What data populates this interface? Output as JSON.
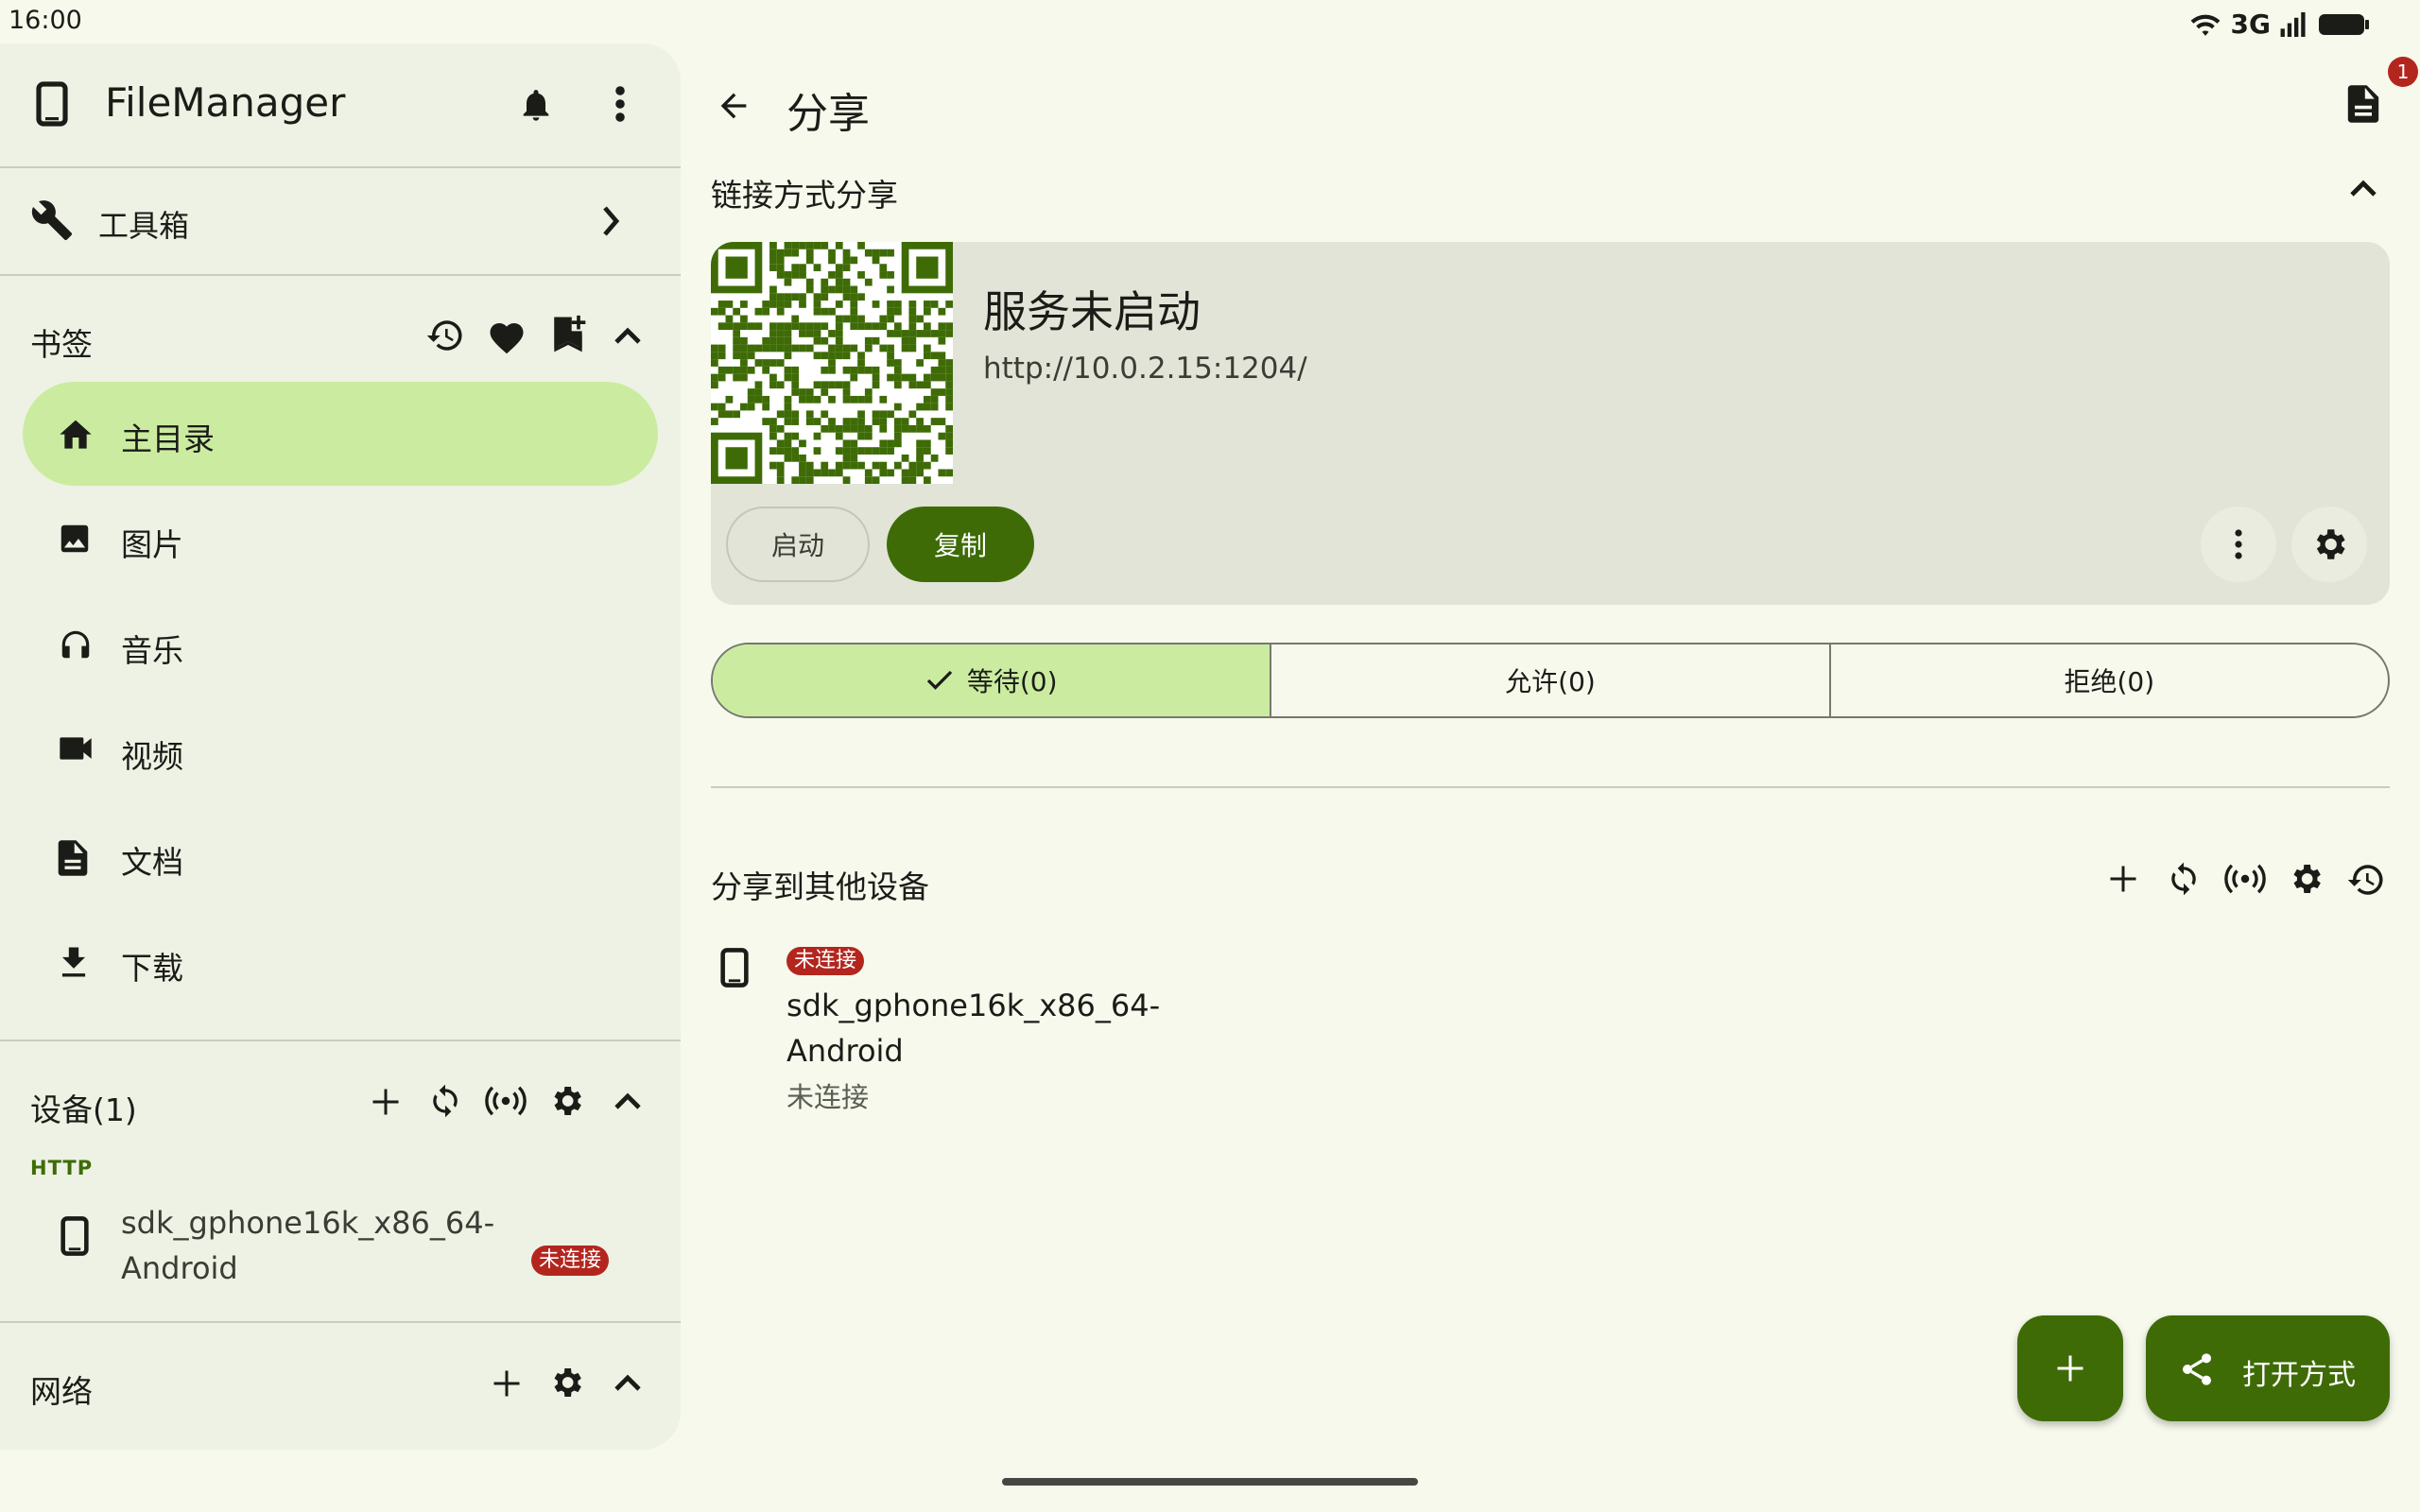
{
  "status_bar": {
    "time": "16:00",
    "network": "3G",
    "icons": [
      "wifi-icon",
      "signal-icon",
      "battery-icon"
    ]
  },
  "drawer": {
    "app_title": "FileManager",
    "header_icons": [
      "phone-icon",
      "bell-icon",
      "more-vert-icon"
    ],
    "toolbox_label": "工具箱",
    "bookmarks": {
      "title": "书签",
      "actions": [
        "history-icon",
        "heart-icon",
        "bookmark-add-icon",
        "chevron-up-icon"
      ],
      "items": [
        {
          "label": "主目录",
          "icon": "home-icon",
          "active": true
        },
        {
          "label": "图片",
          "icon": "image-icon",
          "active": false
        },
        {
          "label": "音乐",
          "icon": "headphones-icon",
          "active": false
        },
        {
          "label": "视频",
          "icon": "video-icon",
          "active": false
        },
        {
          "label": "文档",
          "icon": "document-icon",
          "active": false
        },
        {
          "label": "下载",
          "icon": "download-icon",
          "active": false
        }
      ]
    },
    "devices": {
      "title": "设备(1)",
      "actions": [
        "add-icon",
        "sync-icon",
        "broadcast-icon",
        "gear-icon",
        "chevron-up-icon"
      ],
      "group_label": "HTTP",
      "device_name": "sdk_gphone16k_x86_64-Android",
      "device_status": "未连接"
    },
    "network": {
      "title": "网络",
      "actions": [
        "add-icon",
        "gear-icon",
        "chevron-up-icon"
      ]
    }
  },
  "main": {
    "title": "分享",
    "notification_count": "1",
    "link_share": {
      "title": "链接方式分享",
      "status": "服务未启动",
      "url": "http://10.0.2.15:1204/",
      "start_label": "启动",
      "copy_label": "复制"
    },
    "segments": [
      {
        "label": "等待(0)",
        "selected": true
      },
      {
        "label": "允许(0)",
        "selected": false
      },
      {
        "label": "拒绝(0)",
        "selected": false
      }
    ],
    "share_to_devices": {
      "title": "分享到其他设备",
      "actions": [
        "add-icon",
        "sync-icon",
        "broadcast-icon",
        "gear-icon",
        "history-icon"
      ],
      "device": {
        "badge": "未连接",
        "name": "sdk_gphone16k_x86_64-Android",
        "status": "未连接"
      }
    },
    "fab_open_with": "打开方式"
  },
  "colors": {
    "primary": "#3e6b06",
    "selected_bg": "#cbeca0",
    "error": "#b3261e",
    "background": "#f6f9ec",
    "drawer_bg": "#eef2e4",
    "card_bg": "#e1e4d6"
  }
}
